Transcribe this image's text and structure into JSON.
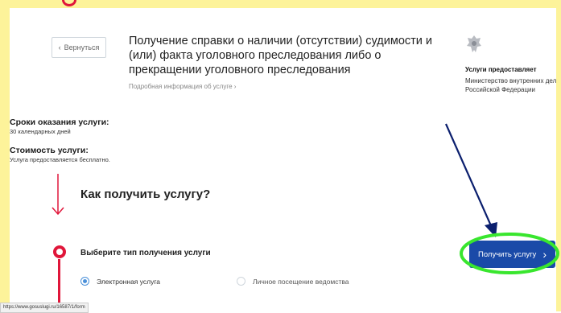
{
  "header": {
    "back_label": "Вернуться",
    "title": "Получение справки о наличии (отсутствии) судимости и (или) факта уголовного преследования либо о прекращении уголовного преследования",
    "details_link": "Подробная информация об услуге"
  },
  "provider": {
    "label": "Услуги предоставляет",
    "name": "Министерство внутренних дел Российской Федерации"
  },
  "info": {
    "terms_label": "Сроки оказания услуги:",
    "terms_value": "30 календарных дней",
    "cost_label": "Стоимость услуги:",
    "cost_value": "Услуга предоставляется бесплатно."
  },
  "how": {
    "heading": "Как получить услугу?",
    "step_label": "Выберите тип получения услуги",
    "options": [
      {
        "label": "Электронная услуга",
        "selected": true
      },
      {
        "label": "Личное посещение ведомства",
        "selected": false
      }
    ]
  },
  "cta": {
    "label": "Получить услугу"
  },
  "status_bar": {
    "url": "https://www.gosuslugi.ru/16587/1/form"
  },
  "colors": {
    "accent_red": "#e0163a",
    "button_blue": "#1a4aa8",
    "radio_blue": "#4a90d9",
    "frame_yellow": "#fdf39a",
    "annotation_green": "#39e62e",
    "annotation_arrow": "#0b1f6e"
  }
}
